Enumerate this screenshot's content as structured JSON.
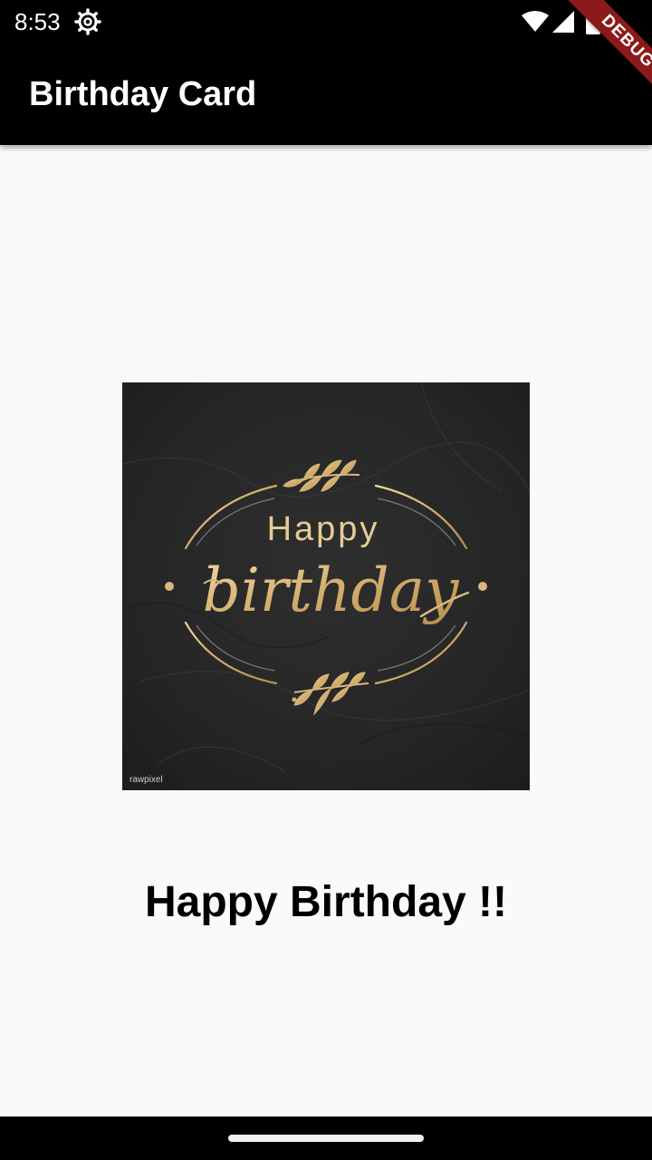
{
  "status_bar": {
    "time": "8:53",
    "icons": [
      "settings-icon",
      "wifi-icon",
      "signal-icon",
      "battery-icon"
    ]
  },
  "app_bar": {
    "title": "Birthday Card",
    "background_color": "#000000"
  },
  "debug_banner": {
    "label": "DEBUG",
    "color": "#8b1a1a"
  },
  "card_image": {
    "text_line1": "Happy",
    "text_line2": "birthday",
    "watermark": "rawpixel",
    "background_color": "#2a2a2a",
    "accent_color": "#d9b77f"
  },
  "message": {
    "text": "Happy Birthday !!"
  },
  "nav_bar": {
    "icons": [
      "home-handle"
    ]
  }
}
